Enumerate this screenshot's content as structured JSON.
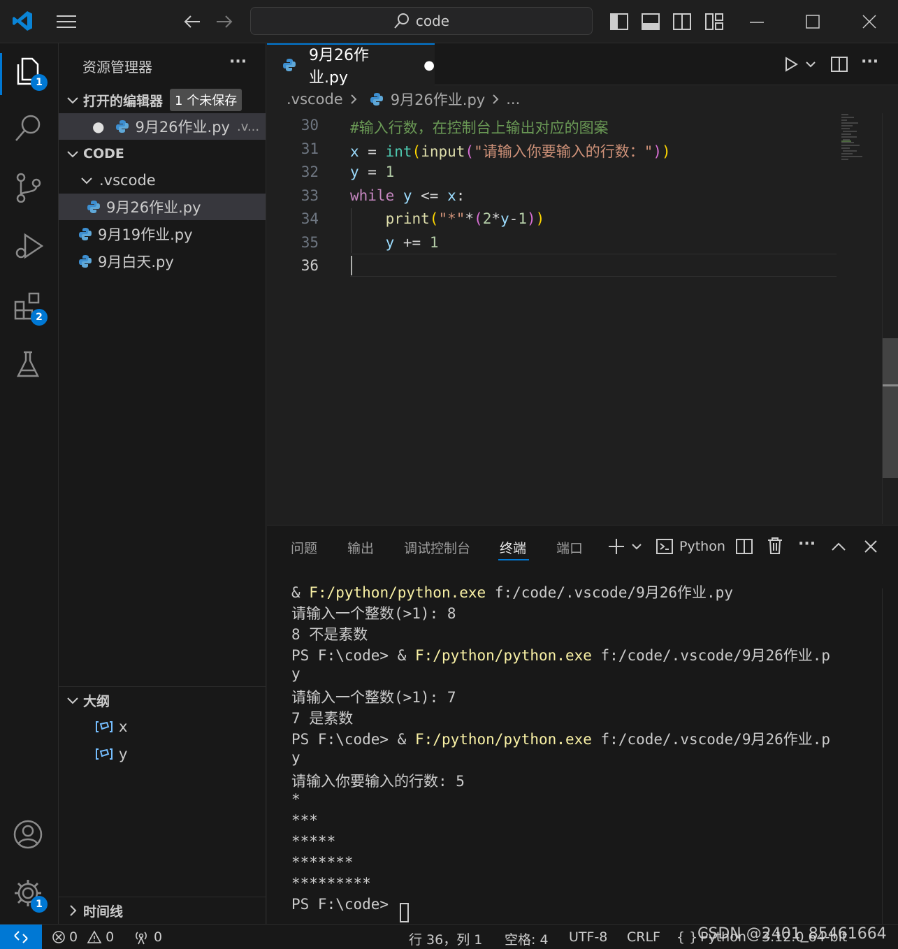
{
  "titlebar": {
    "search_text": "code"
  },
  "activity": {
    "explorer_badge": "1",
    "extensions_badge": "2",
    "settings_badge": "1"
  },
  "sidebar": {
    "title": "资源管理器",
    "more": "···",
    "open_editors": {
      "label": "打开的编辑器",
      "badge": "1 个未保存",
      "file": "9月26作业.py",
      "file_suffix": ".v..."
    },
    "folder": {
      "label": "CODE",
      "subfolder": ".vscode",
      "files": [
        "9月26作业.py",
        "9月19作业.py",
        "9月白天.py"
      ]
    },
    "outline": {
      "label": "大纲",
      "items": [
        "x",
        "y"
      ]
    },
    "timeline": {
      "label": "时间线"
    }
  },
  "editor": {
    "tab_label": "9月26作业.py",
    "tab_dirty": "●",
    "breadcrumb": {
      "folder": ".vscode",
      "file": "9月26作业.py",
      "more": "..."
    },
    "line_numbers": [
      "30",
      "31",
      "32",
      "33",
      "34",
      "35",
      "36"
    ],
    "lines": [
      [
        {
          "t": "#输入行数，在控制台上输出对应的图案",
          "c": "#6a9955"
        }
      ],
      [
        {
          "t": "x",
          "c": "#9cdcfe"
        },
        {
          "t": " = ",
          "c": "#d4d4d4"
        },
        {
          "t": "int",
          "c": "#4ec9b0"
        },
        {
          "t": "(",
          "c": "#ffd700"
        },
        {
          "t": "input",
          "c": "#dcdcaa"
        },
        {
          "t": "(",
          "c": "#da70d6"
        },
        {
          "t": "\"请输入你要输入的行数：\"",
          "c": "#ce9178"
        },
        {
          "t": ")",
          "c": "#da70d6"
        },
        {
          "t": ")",
          "c": "#ffd700"
        }
      ],
      [
        {
          "t": "y",
          "c": "#9cdcfe"
        },
        {
          "t": " = ",
          "c": "#d4d4d4"
        },
        {
          "t": "1",
          "c": "#b5cea8"
        }
      ],
      [
        {
          "t": "while",
          "c": "#c586c0"
        },
        {
          "t": " y ",
          "c": "#9cdcfe"
        },
        {
          "t": "<= ",
          "c": "#d4d4d4"
        },
        {
          "t": "x",
          "c": "#9cdcfe"
        },
        {
          "t": ":",
          "c": "#d4d4d4"
        }
      ],
      [
        {
          "t": "    ",
          "c": "#d4d4d4"
        },
        {
          "t": "print",
          "c": "#dcdcaa"
        },
        {
          "t": "(",
          "c": "#ffd700"
        },
        {
          "t": "\"*\"",
          "c": "#ce9178"
        },
        {
          "t": "*",
          "c": "#d4d4d4"
        },
        {
          "t": "(",
          "c": "#da70d6"
        },
        {
          "t": "2",
          "c": "#b5cea8"
        },
        {
          "t": "*",
          "c": "#d4d4d4"
        },
        {
          "t": "y",
          "c": "#9cdcfe"
        },
        {
          "t": "-",
          "c": "#d4d4d4"
        },
        {
          "t": "1",
          "c": "#b5cea8"
        },
        {
          "t": ")",
          "c": "#da70d6"
        },
        {
          "t": ")",
          "c": "#ffd700"
        }
      ],
      [
        {
          "t": "    ",
          "c": "#d4d4d4"
        },
        {
          "t": "y",
          "c": "#9cdcfe"
        },
        {
          "t": " += ",
          "c": "#d4d4d4"
        },
        {
          "t": "1",
          "c": "#b5cea8"
        }
      ],
      []
    ]
  },
  "panel": {
    "tabs": [
      "问题",
      "输出",
      "调试控制台",
      "终端",
      "端口"
    ],
    "active_tab": "终端",
    "terminal_label": "Python",
    "terminal_lines": [
      [
        {
          "t": "& ",
          "c": "#cccccc"
        },
        {
          "t": "F:/python/python.exe",
          "c": "#f9f1a5"
        },
        {
          "t": " f:/code/.vscode/9月26作业.py",
          "c": "#cccccc"
        }
      ],
      [
        {
          "t": "请输入一个整数(>1): 8",
          "c": "#cccccc"
        }
      ],
      [
        {
          "t": "8 不是素数",
          "c": "#cccccc"
        }
      ],
      [
        {
          "t": "PS F:\\code> & ",
          "c": "#cccccc"
        },
        {
          "t": "F:/python/python.exe",
          "c": "#f9f1a5"
        },
        {
          "t": " f:/code/.vscode/9月26作业.p",
          "c": "#cccccc"
        }
      ],
      [
        {
          "t": "y",
          "c": "#cccccc"
        }
      ],
      [
        {
          "t": "请输入一个整数(>1): 7",
          "c": "#cccccc"
        }
      ],
      [
        {
          "t": "7 是素数",
          "c": "#cccccc"
        }
      ],
      [
        {
          "t": "PS F:\\code> & ",
          "c": "#cccccc"
        },
        {
          "t": "F:/python/python.exe",
          "c": "#f9f1a5"
        },
        {
          "t": " f:/code/.vscode/9月26作业.p",
          "c": "#cccccc"
        }
      ],
      [
        {
          "t": "y",
          "c": "#cccccc"
        }
      ],
      [
        {
          "t": "请输入你要输入的行数: 5",
          "c": "#cccccc"
        }
      ],
      [
        {
          "t": "*",
          "c": "#cccccc"
        }
      ],
      [
        {
          "t": "***",
          "c": "#cccccc"
        }
      ],
      [
        {
          "t": "*****",
          "c": "#cccccc"
        }
      ],
      [
        {
          "t": "*******",
          "c": "#cccccc"
        }
      ],
      [
        {
          "t": "*********",
          "c": "#cccccc"
        }
      ],
      [
        {
          "t": "PS F:\\code> ",
          "c": "#cccccc"
        }
      ]
    ]
  },
  "statusbar": {
    "errors": "0",
    "warnings": "0",
    "ports": "0",
    "position": "行 36，列 1",
    "indent": "空格: 4",
    "encoding": "UTF-8",
    "eol": "CRLF",
    "language": "Python",
    "interpreter": "3.12.0 64-bit",
    "watermark": "CSDN @2401_85461664"
  },
  "colors": {
    "accent": "#0078d4",
    "bg": "#1f1f1f",
    "sidebar_bg": "#181818"
  }
}
